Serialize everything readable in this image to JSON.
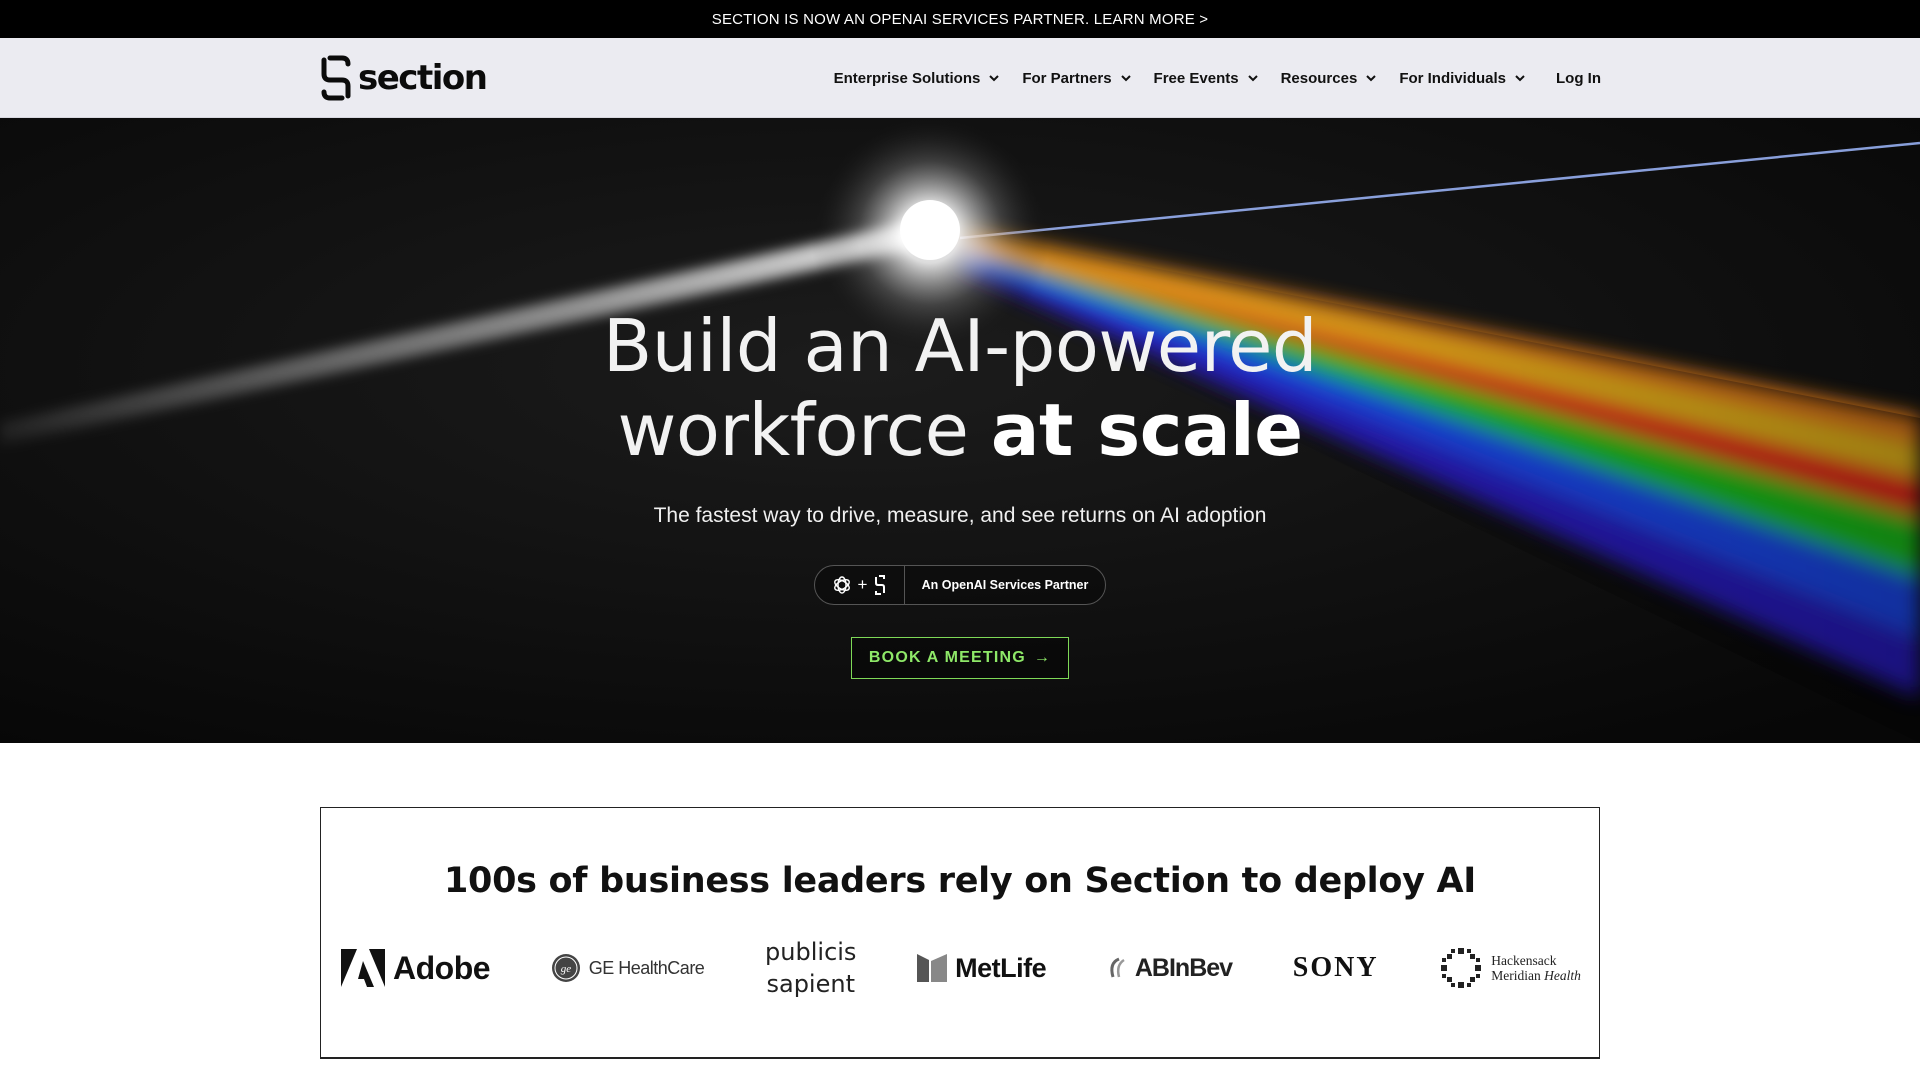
{
  "announcement": {
    "text": "SECTION IS NOW AN OPENAI SERVICES PARTNER. LEARN MORE >"
  },
  "nav": {
    "logo_text": "section",
    "items": [
      {
        "label": "Enterprise Solutions"
      },
      {
        "label": "For Partners"
      },
      {
        "label": "Free Events"
      },
      {
        "label": "Resources"
      },
      {
        "label": "For Individuals"
      }
    ],
    "login_label": "Log In"
  },
  "hero": {
    "title_line1": "Build an AI-powered",
    "title_line2_regular": "workforce ",
    "title_line2_bold": "at scale",
    "subtitle": "The fastest way to drive, measure, and see returns on AI adoption",
    "partner_plus": "+",
    "partner_text": "An OpenAI Services Partner",
    "cta_label": "BOOK A MEETING",
    "cta_arrow": "→",
    "accent_color": "#7ed957"
  },
  "clients": {
    "heading": "100s of business leaders rely on Section to deploy AI",
    "logos": {
      "adobe": "Adobe",
      "ge": "GE HealthCare",
      "publicis_line1": "publicis",
      "publicis_line2": "sapient",
      "metlife": "MetLife",
      "abinbev": "ABInBev",
      "sony": "SONY",
      "hmh_line1": "Hackensack",
      "hmh_line2a": "Meridian ",
      "hmh_line2b": "Health"
    }
  }
}
